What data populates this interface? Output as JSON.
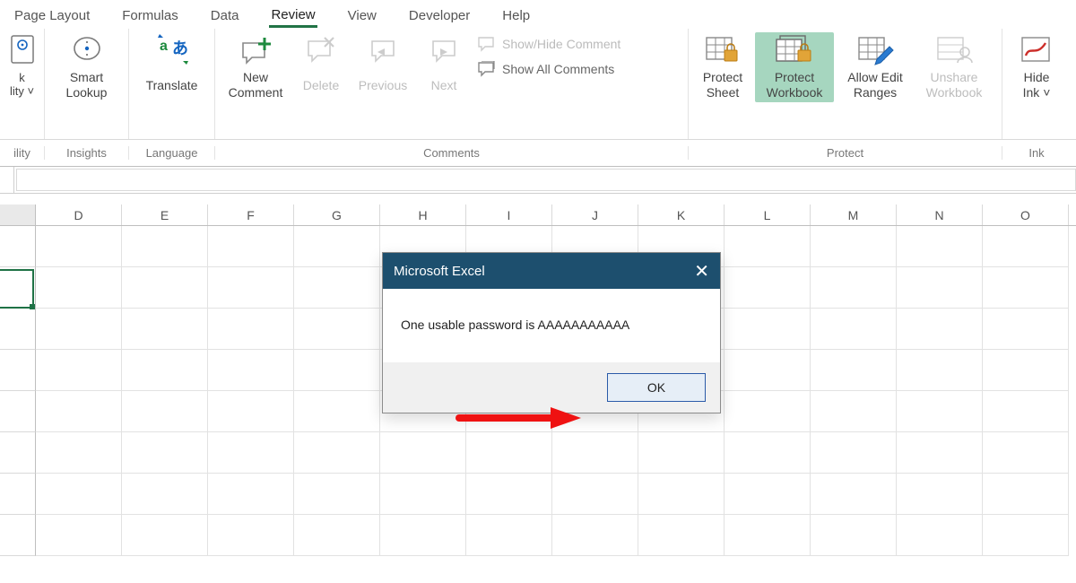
{
  "tabs": {
    "page_layout": "Page Layout",
    "formulas": "Formulas",
    "data": "Data",
    "review": "Review",
    "view": "View",
    "developer": "Developer",
    "help": "Help"
  },
  "ribbon": {
    "accessibility": {
      "line1_partial": "k",
      "line2_partial": "lity",
      "chevron": "˅",
      "group_label": "ility"
    },
    "insights": {
      "smart": "Smart",
      "lookup": "Lookup",
      "group_label": "Insights"
    },
    "language": {
      "translate": "Translate",
      "group_label": "Language"
    },
    "comments": {
      "new": "New\nComment",
      "delete": "Delete",
      "previous": "Previous",
      "next": "Next",
      "show_hide": "Show/Hide Comment",
      "show_all": "Show All Comments",
      "group_label": "Comments"
    },
    "protect": {
      "protect_sheet": "Protect\nSheet",
      "protect_workbook": "Protect\nWorkbook",
      "allow_edit": "Allow Edit\nRanges",
      "unshare": "Unshare\nWorkbook",
      "group_label": "Protect"
    },
    "ink": {
      "hide_ink": "Hide\nInk",
      "chevron": "˅",
      "group_label": "Ink"
    }
  },
  "columns": [
    "D",
    "E",
    "F",
    "G",
    "H",
    "I",
    "J",
    "K",
    "L",
    "M",
    "N",
    "O"
  ],
  "dialog": {
    "title": "Microsoft Excel",
    "body": "One usable password is AAAAAAAAAAA",
    "ok": "OK"
  }
}
